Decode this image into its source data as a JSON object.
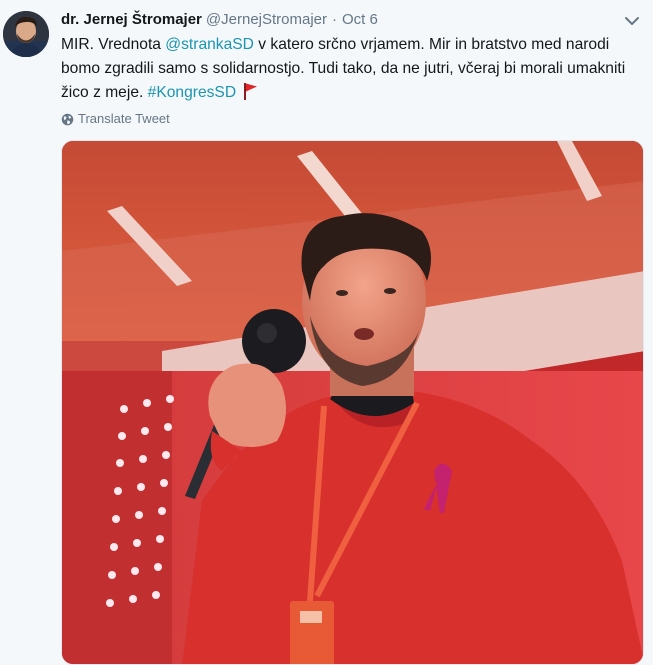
{
  "tweet": {
    "author": {
      "fullname": "dr. Jernej Štromajer",
      "handle": "@JernejStromajer"
    },
    "separator": "·",
    "date": "Oct 6",
    "text": {
      "part1": "MIR. Vrednota ",
      "mention": "@strankaSD",
      "part2": " v katero srčno vrjamem. Mir in bratstvo med narodi bomo zgradili samo s solidarnostjo. Tudi tako, da ne jutri, včeraj bi morali umakniti žico z meje. ",
      "hashtag": "#KongresSD"
    },
    "translate_label": "Translate Tweet"
  },
  "icons": {
    "caret": "chevron-down-icon",
    "flag": "red-flag-emoji",
    "globe": "globe-icon"
  },
  "colors": {
    "link": "#1b95b0",
    "secondary_text": "#657786",
    "background": "#f5f8fa",
    "photo_red": "#d8322c"
  }
}
